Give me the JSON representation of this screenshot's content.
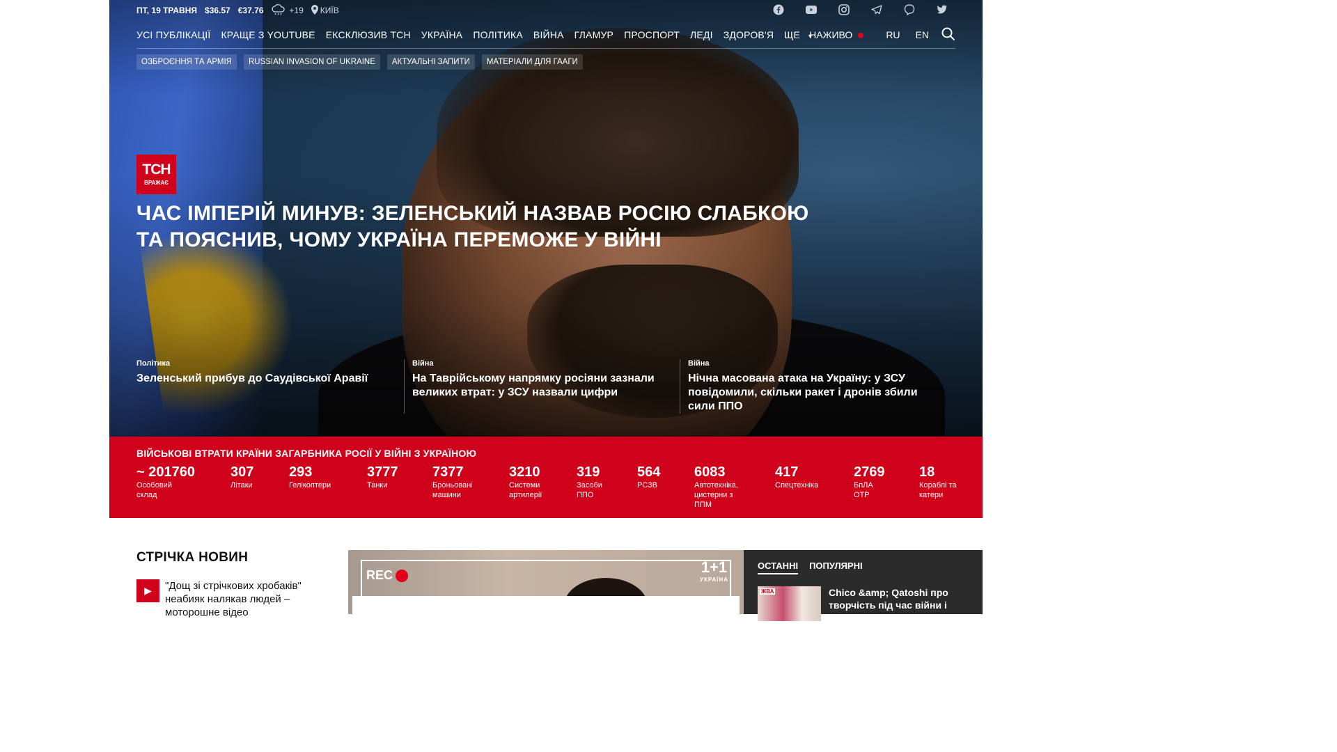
{
  "topbar": {
    "date": "ПТ, 19 ТРАВНЯ",
    "usd": "$36.57",
    "eur": "€37.76",
    "weather_icon": "cloud-rain-icon",
    "temp": "+19",
    "city": "КИЇВ"
  },
  "social": [
    "facebook-icon",
    "youtube-icon",
    "instagram-icon",
    "telegram-icon",
    "viber-icon",
    "twitter-icon"
  ],
  "nav": {
    "items": [
      "УСІ ПУБЛІКАЦІЇ",
      "КРАЩЕ З YOUTUBE",
      "ЕКСКЛЮЗИВ ТСН",
      "УКРАЇНА",
      "ПОЛІТИКА",
      "ВІЙНА",
      "ГЛАМУР",
      "ПРОСПОРТ",
      "ЛЕДІ",
      "ЗДОРОВ'Я",
      "ЩЕ"
    ],
    "live": "НАЖИВО",
    "lang_ru": "RU",
    "lang_en": "EN"
  },
  "tags": [
    "ОЗБРОЄННЯ ТА АРМІЯ",
    "RUSSIAN INVASION OF UKRAINE",
    "АКТУАЛЬНІ ЗАПИТИ",
    "МАТЕРІАЛИ ДЛЯ ГААГИ"
  ],
  "hero": {
    "logo_main": "ТСН",
    "logo_sub": "ВРАЖАЄ",
    "headline": "ЧАС ІМПЕРІЙ МИНУВ: ЗЕЛЕНСЬКИЙ НАЗВАВ РОСІЮ СЛАБКОЮ ТА ПОЯСНИВ, ЧОМУ УКРАЇНА ПЕРЕМОЖЕ У ВІЙНІ",
    "subs": [
      {
        "cat": "Політика",
        "title": "Зеленський прибув до Саудівської Аравії"
      },
      {
        "cat": "Війна",
        "title": "На Таврійському напрямку росіяни зазнали великих втрат: у ЗСУ назвали цифри"
      },
      {
        "cat": "Війна",
        "title": "Нічна масована атака на Україну: у ЗСУ повідомили, скільки ракет і дронів збили сили ППО"
      }
    ]
  },
  "losses": {
    "title": "ВІЙСЬКОВІ ВТРАТИ КРАЇНИ ЗАГАРБНИКА РОСІЇ У ВІЙНІ З УКРАЇНОЮ",
    "stats": [
      {
        "n": "~ 201760",
        "l": "Особовий склад"
      },
      {
        "n": "307",
        "l": "Літаки"
      },
      {
        "n": "293",
        "l": "Гелікоптери"
      },
      {
        "n": "3777",
        "l": "Танки"
      },
      {
        "n": "7377",
        "l": "Броньовані машини"
      },
      {
        "n": "3210",
        "l": "Системи артилерії"
      },
      {
        "n": "319",
        "l": "Засоби ППО"
      },
      {
        "n": "564",
        "l": "РСЗВ"
      },
      {
        "n": "6083",
        "l": "Автотехніка, цистерни з ППМ"
      },
      {
        "n": "417",
        "l": "Спецтехніка"
      },
      {
        "n": "2769",
        "l": "БпЛА ОТР"
      },
      {
        "n": "18",
        "l": "Кораблі та катери"
      }
    ]
  },
  "feed": {
    "title": "СТРІЧКА НОВИН",
    "item": "\"Дощ зі стрічкових хробаків\" неабияк налякав людей – моторошне відео"
  },
  "video": {
    "rec": "REC",
    "channel": "1+1",
    "channel_sub": "УКРАЇНА"
  },
  "side": {
    "tab_latest": "ОСТАННІ",
    "tab_popular": "ПОПУЛЯРНІ",
    "thumb_badge": "ЖВА",
    "item": "Chico &amp; Qatoshi про творчість під час війни і"
  }
}
